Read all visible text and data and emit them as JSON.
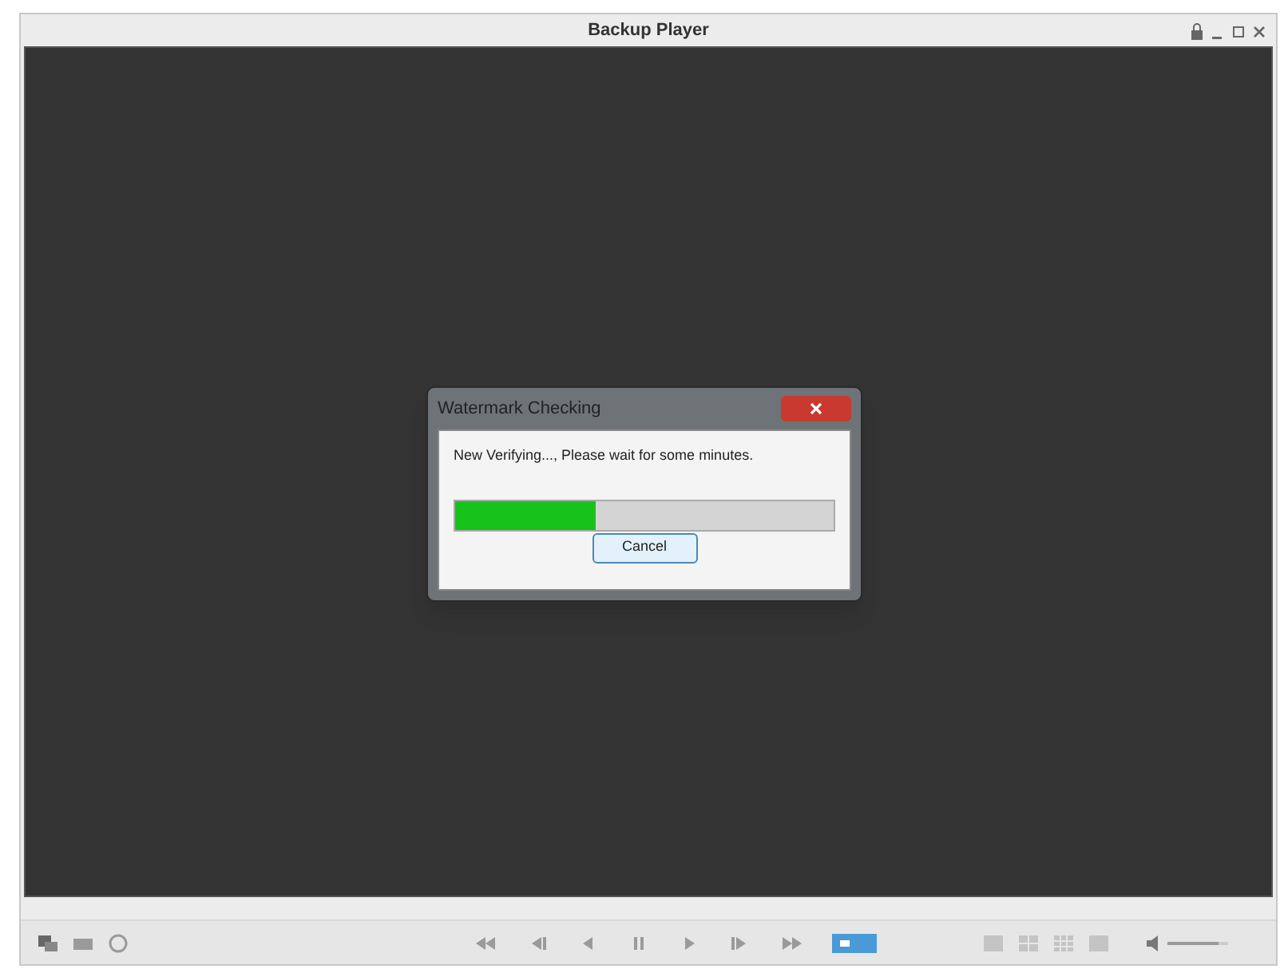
{
  "window": {
    "title": "Backup Player"
  },
  "dialog": {
    "title": "Watermark Checking",
    "message": "New Verifying..., Please wait for some minutes.",
    "progress": {
      "level": 0.37
    },
    "button": "Cancel"
  },
  "volume": {
    "level": 0.85
  }
}
